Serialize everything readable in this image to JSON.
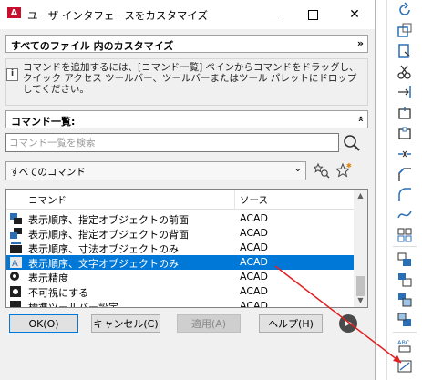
{
  "window": {
    "title": "ユーザ インタフェースをカスタマイズ",
    "app_logo": "A"
  },
  "sections": {
    "customize_header": "すべてのファイル 内のカスタマイズ",
    "command_list_header": "コマンド一覧:"
  },
  "info": {
    "icon": "info-icon",
    "text": "コマンドを追加するには、[コマンド一覧] ペインからコマンドをドラッグし、クイック アクセス ツールバー、ツールバーまたはツール パレットにドロップしてください。"
  },
  "search": {
    "placeholder": "コマンド一覧を検索",
    "value": ""
  },
  "filter": {
    "selected": "すべてのコマンド"
  },
  "list": {
    "columns": [
      "コマンド",
      "ソース"
    ],
    "rows": [
      {
        "name": "表示順序、指定オブジェクトの前面",
        "source": "ACAD",
        "selected": false
      },
      {
        "name": "表示順序、指定オブジェクトの背面",
        "source": "ACAD",
        "selected": false
      },
      {
        "name": "表示順序、寸法オブジェクトのみ",
        "source": "ACAD",
        "selected": false
      },
      {
        "name": "表示順序、文字オブジェクトのみ",
        "source": "ACAD",
        "selected": true
      },
      {
        "name": "表示精度",
        "source": "ACAD",
        "selected": false
      },
      {
        "name": "不可視にする",
        "source": "ACAD",
        "selected": false
      },
      {
        "name": "標準ツールバー設定",
        "source": "ACAD",
        "selected": false
      }
    ]
  },
  "buttons": {
    "ok": "OK(O)",
    "cancel": "キャンセル(C)",
    "apply": "適用(A)",
    "help": "ヘルプ(H)"
  },
  "colors": {
    "selection": "#0078d7",
    "annotation_arrow": "#e02020",
    "logo": "#c8102e"
  }
}
